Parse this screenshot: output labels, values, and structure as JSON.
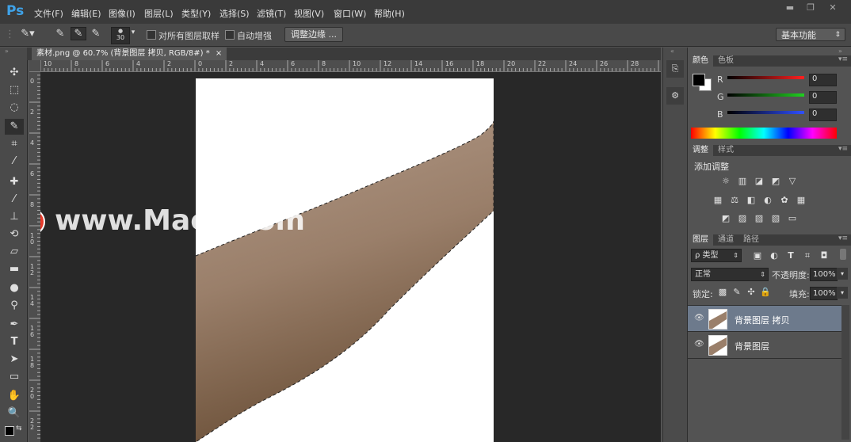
{
  "app": {
    "logo": "Ps"
  },
  "menu": [
    "文件(F)",
    "编辑(E)",
    "图像(I)",
    "图层(L)",
    "类型(Y)",
    "选择(S)",
    "滤镜(T)",
    "视图(V)",
    "窗口(W)",
    "帮助(H)"
  ],
  "window_controls": {
    "minimize": "▬",
    "restore": "❐",
    "close": "✕"
  },
  "options": {
    "brush_size": "30",
    "sample_all_label": "对所有图层取样",
    "auto_enhance_label": "自动增强",
    "refine_edge_button": "调整边缘 ...",
    "workspace": "基本功能"
  },
  "document": {
    "tab_title": "素材.png @ 60.7% (背景图层 拷贝, RGB/8#) *",
    "tab_close": "×"
  },
  "ruler_top_ticks": [
    "10",
    "8",
    "6",
    "4",
    "2",
    "0",
    "2",
    "4",
    "6",
    "8",
    "10",
    "12",
    "14",
    "16",
    "18",
    "20",
    "22",
    "24",
    "26",
    "28"
  ],
  "ruler_left_ticks": [
    "0",
    "2",
    "4",
    "6",
    "8",
    "1 0",
    "1 2",
    "1 4",
    "1 6",
    "1 8",
    "2 0",
    "2 2"
  ],
  "watermark": {
    "text": "www.MacZ.com",
    "badge": "Z"
  },
  "color_panel": {
    "tabs": [
      "颜色",
      "色板"
    ],
    "channels": [
      {
        "name": "R",
        "value": "0",
        "color": "#e03030"
      },
      {
        "name": "G",
        "value": "0",
        "color": "#30c030"
      },
      {
        "name": "B",
        "value": "0",
        "color": "#3050e0"
      }
    ]
  },
  "adjust_panel": {
    "tabs": [
      "调整",
      "样式"
    ],
    "title": "添加调整",
    "row1": [
      "☼",
      "▥",
      "◪",
      "◩",
      "▽"
    ],
    "row2": [
      "▦",
      "⚖",
      "◧",
      "◐",
      "✿",
      "▦"
    ],
    "row3": [
      "◩",
      "▨",
      "▨",
      "▧",
      "▭"
    ]
  },
  "layers_panel": {
    "tabs": [
      "图层",
      "通道",
      "路径"
    ],
    "filter_label": "ρ 类型",
    "blend_mode": "正常",
    "opacity_label": "不透明度:",
    "opacity_value": "100%",
    "lock_label": "锁定:",
    "fill_label": "填充:",
    "fill_value": "100%",
    "layers": [
      {
        "name": "背景图层 拷贝",
        "selected": true
      },
      {
        "name": "背景图层",
        "selected": false
      }
    ]
  },
  "colors": {
    "accent": "#3fa2e8",
    "watermark_badge": "#e83a2a",
    "selected_layer": "#6d7a8c"
  }
}
